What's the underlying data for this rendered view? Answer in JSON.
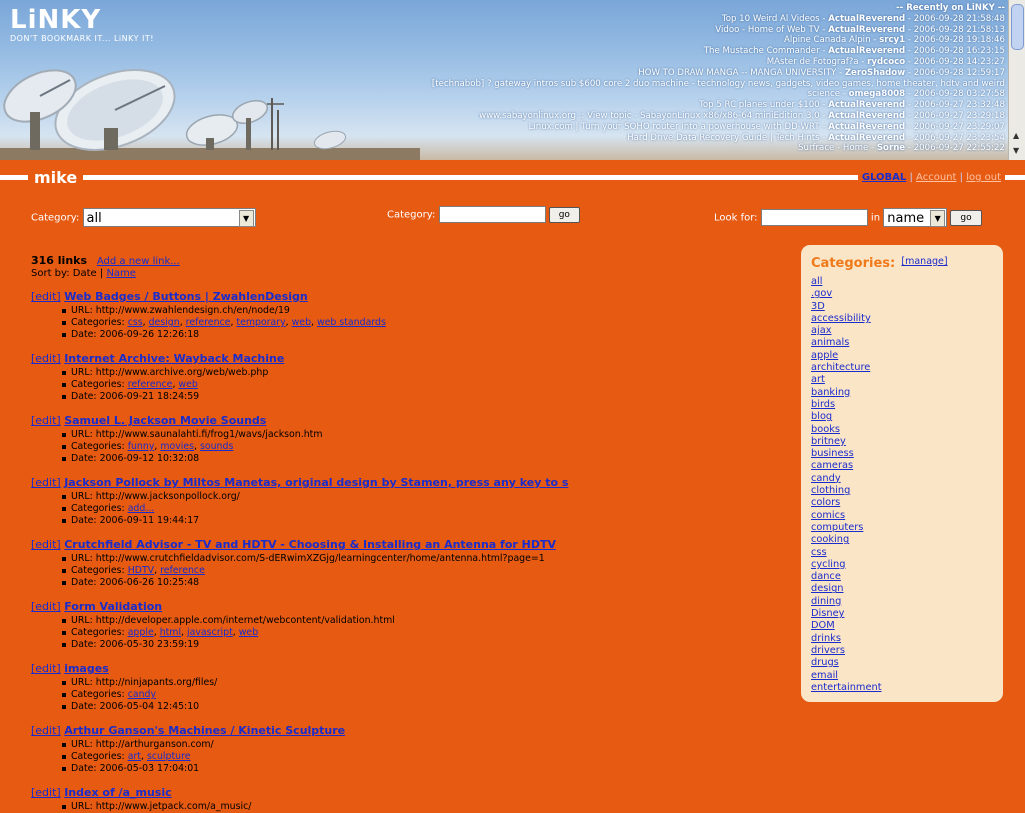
{
  "app": {
    "name": "LiNKY",
    "tagline": "DON'T BOOKMARK IT... LiNKY IT!"
  },
  "recent": {
    "title": "-- Recently on LiNKY --",
    "rows": [
      {
        "text": "Top 10 Weird Al Videos",
        "user": "ActualReverend",
        "date": "2006-09-28 21:58:48"
      },
      {
        "text": "Vidoo - Home of Web TV",
        "user": "ActualReverend",
        "date": "2006-09-28 21:58:13"
      },
      {
        "text": "Alpine Canada Alpin",
        "user": "srcy1",
        "date": "2006-09-28 19:18:46"
      },
      {
        "text": "The Mustache Commander",
        "user": "ActualReverend",
        "date": "2006-09-28 16:23:15"
      },
      {
        "text": "MAster de Fotograf?a",
        "user": "rydcoco",
        "date": "2006-09-28 14:23:27"
      },
      {
        "text": "HOW TO DRAW MANGA -- MANGA UNIVERSITY",
        "user": "ZeroShadow",
        "date": "2006-09-28 12:59:17"
      },
      {
        "text": "[technabob] ? gateway intros sub $600 core 2 duo machine - technology news, gadgets, video games, home theater, hdtv and weird science",
        "user": "omega8008",
        "date": "2006-09-28 03:27:58"
      },
      {
        "text": "Top 5 RC planes under $100",
        "user": "ActualReverend",
        "date": "2006-09-27 23:32:48"
      },
      {
        "text": "www.sabayonlinux.org :: View topic - SabayonLinux x86/x86-64 miniEdition 3.0",
        "user": "ActualReverend",
        "date": "2006-09-27 23:29:18"
      },
      {
        "text": "Linux.com | Turn your SOHO router into a powerhouse with DD-WRT",
        "user": "ActualReverend",
        "date": "2006-09-27 23:29:07"
      },
      {
        "text": "Hard Drive Data Recovery Guide | Tech Hints",
        "user": "ActualReverend",
        "date": "2006-09-27 23:23:54"
      },
      {
        "text": "Surfrace - Home",
        "user": "Sorne",
        "date": "2006-09-27 22:55:22"
      }
    ]
  },
  "userbar": {
    "username": "mike",
    "global": "GLOBAL",
    "account": "Account",
    "logout": "log out",
    "sep": "|"
  },
  "filters": {
    "category_label": "Category:",
    "category_selected": "all",
    "category2_label": "Category:",
    "category2_value": "",
    "go": "go",
    "lookfor_label": "Look for:",
    "lookfor_value": "",
    "in_label": "in",
    "field_selected": "name"
  },
  "list": {
    "count": "316 links",
    "add_link": "Add a new link...",
    "sort_label": "Sort by:",
    "sort_date": "Date",
    "sort_sep": "|",
    "sort_name": "Name",
    "edit_label": "[edit]",
    "url_label": "URL:",
    "cat_label": "Categories:",
    "date_label": "Date:",
    "items": [
      {
        "title": "Web Badges / Buttons | ZwahlenDesign",
        "url": "http://www.zwahlendesign.ch/en/node/19",
        "cats": [
          "css",
          "design",
          "reference",
          "temporary",
          "web",
          "web standards"
        ],
        "date": "2006-09-26 12:26:18"
      },
      {
        "title": "Internet Archive: Wayback Machine",
        "url": "http://www.archive.org/web/web.php",
        "cats": [
          "reference",
          "web"
        ],
        "date": "2006-09-21 18:24:59"
      },
      {
        "title": "Samuel L. Jackson Movie Sounds",
        "url": "http://www.saunalahti.fi/frog1/wavs/jackson.htm",
        "cats": [
          "funny",
          "movies",
          "sounds"
        ],
        "date": "2006-09-12 10:32:08"
      },
      {
        "title": "Jackson Pollock by Miltos Manetas, original design by Stamen, press any key to s",
        "url": "http://www.jacksonpollock.org/",
        "cats": [
          "add..."
        ],
        "date": "2006-09-11 19:44:17"
      },
      {
        "title": "Crutchfield Advisor - TV and HDTV - Choosing & Installing an Antenna for HDTV",
        "url": "http://www.crutchfieldadvisor.com/S-dERwimXZGjg/learningcenter/home/antenna.html?page=1",
        "cats": [
          "HDTV",
          "reference"
        ],
        "date": "2006-06-26 10:25:48"
      },
      {
        "title": "Form Validation",
        "url": "http://developer.apple.com/internet/webcontent/validation.html",
        "cats": [
          "apple",
          "html",
          "javascript",
          "web"
        ],
        "date": "2006-05-30 23:59:19"
      },
      {
        "title": "images",
        "url": "http://ninjapants.org/files/",
        "cats": [
          "candy"
        ],
        "date": "2006-05-04 12:45:10"
      },
      {
        "title": "Arthur Ganson's Machines / Kinetic Sculpture",
        "url": "http://arthurganson.com/",
        "cats": [
          "art",
          "sculpture"
        ],
        "date": "2006-05-03 17:04:01"
      },
      {
        "title": "Index of /a_music",
        "url": "http://www.jetpack.com/a_music/",
        "cats": [],
        "date": ""
      }
    ]
  },
  "categories": {
    "title": "Categories:",
    "manage": "[manage]",
    "items": [
      "all",
      ".gov",
      "3D",
      "accessibility",
      "ajax",
      "animals",
      "apple",
      "architecture",
      "art",
      "banking",
      "birds",
      "blog",
      "books",
      "britney",
      "business",
      "cameras",
      "candy",
      "clothing",
      "colors",
      "comics",
      "computers",
      "cooking",
      "css",
      "cycling",
      "dance",
      "design",
      "dining",
      "Disney",
      "DOM",
      "drinks",
      "drivers",
      "drugs",
      "email",
      "entertainment"
    ]
  },
  "icons": {
    "dropdown": "dropdown-arrow-icon",
    "scroll_up": "scroll-up-icon",
    "scroll_down": "scroll-down-icon"
  },
  "colors": {
    "background": "#e65a12",
    "panel": "#fbe5c7",
    "panel_title": "#f07a19",
    "link": "#1a2ccc"
  }
}
